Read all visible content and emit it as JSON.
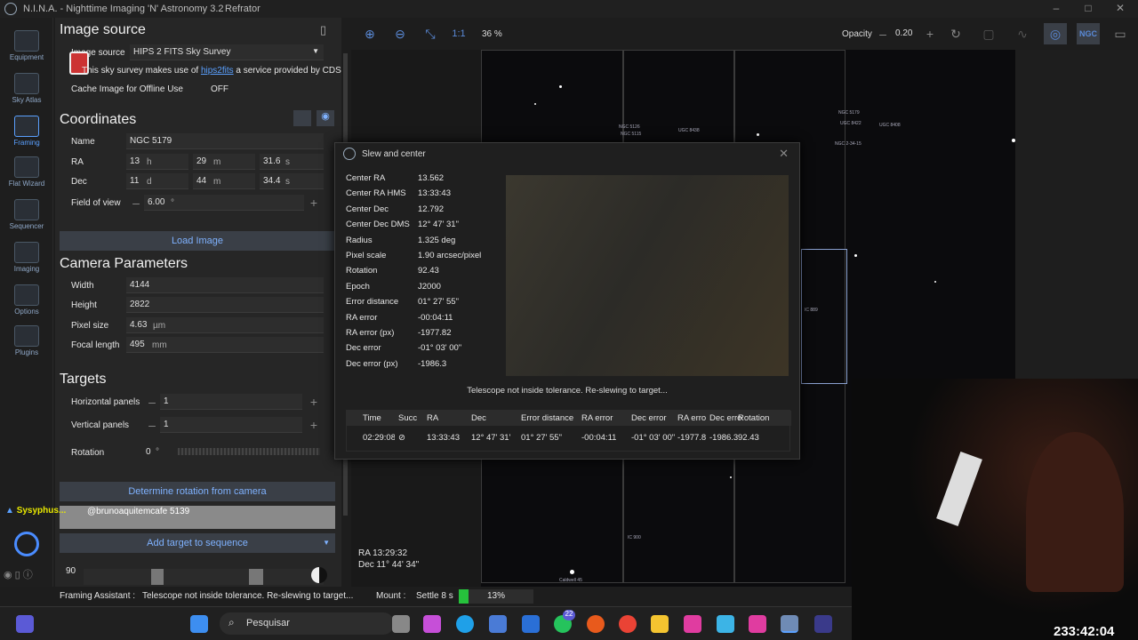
{
  "window": {
    "title": "N.I.N.A. - Nighttime Imaging 'N' Astronomy 3.2",
    "profile": "Refrator"
  },
  "sidebar": {
    "items": [
      {
        "label": "Equipment"
      },
      {
        "label": "Sky Atlas"
      },
      {
        "label": "Framing"
      },
      {
        "label": "Flat Wizard"
      },
      {
        "label": "Sequencer"
      },
      {
        "label": "Imaging"
      },
      {
        "label": "Options"
      },
      {
        "label": "Plugins"
      }
    ],
    "collapse": "< <"
  },
  "image_source": {
    "header": "Image source",
    "label": "Image source",
    "value": "HIPS 2 FITS Sky Survey",
    "note_prefix": "This sky survey makes use of",
    "note_link": "hips2fits",
    "note_suffix": "a service provided by CDS",
    "cache_label": "Cache Image for Offline Use",
    "cache_value": "OFF"
  },
  "coordinates": {
    "header": "Coordinates",
    "name_label": "Name",
    "name": "NGC 5179",
    "ra_label": "RA",
    "ra_h": "13",
    "ra_h_unit": "h",
    "ra_m": "29",
    "ra_m_unit": "m",
    "ra_s": "31.6",
    "ra_s_unit": "s",
    "dec_label": "Dec",
    "dec_d": "11",
    "dec_d_unit": "d",
    "dec_m": "44",
    "dec_m_unit": "m",
    "dec_s": "34.4",
    "dec_s_unit": "s",
    "fov_label": "Field of view",
    "fov": "6.00",
    "fov_unit": "°",
    "load": "Load Image"
  },
  "camera": {
    "header": "Camera Parameters",
    "width_label": "Width",
    "width": "4144",
    "height_label": "Height",
    "height": "2822",
    "pixel_label": "Pixel size",
    "pixel": "4.63",
    "pixel_unit": "µm",
    "focal_label": "Focal length",
    "focal": "495",
    "focal_unit": "mm"
  },
  "targets": {
    "header": "Targets",
    "hpanels_label": "Horizontal panels",
    "hpanels": "1",
    "vpanels_label": "Vertical panels",
    "vpanels": "1",
    "rotation_label": "Rotation",
    "rotation": "0",
    "rotation_unit": "°",
    "determine": "Determine rotation from camera",
    "add": "Add target to sequence"
  },
  "chat": {
    "user": "Sysyphus...",
    "message": "@brunoaquitemcafe 5139"
  },
  "bottom_value": "90",
  "toolbar": {
    "zoom_11": "1:1",
    "zoom": "36 %",
    "opacity_label": "Opacity",
    "opacity": "0.20",
    "ngc": "NGC"
  },
  "sky": {
    "ra": "RA  13:29:32",
    "dec": "Dec  11° 44' 34\"",
    "labels": [
      "NGC 5126",
      "NGC 5115",
      "UGC 8438",
      "NGC 5179",
      "UGC 8422",
      "UGC 8408",
      "NGC 2-34-15",
      "IC 889",
      "IC 900",
      "Caldwell 45"
    ]
  },
  "dialog": {
    "title": "Slew and center",
    "rows": [
      {
        "k": "Center RA",
        "v": "13.562"
      },
      {
        "k": "Center RA HMS",
        "v": "13:33:43"
      },
      {
        "k": "Center Dec",
        "v": "12.792"
      },
      {
        "k": "Center Dec DMS",
        "v": "12° 47' 31\""
      },
      {
        "k": "Radius",
        "v": "1.325 deg"
      },
      {
        "k": "Pixel scale",
        "v": "1.90 arcsec/pixel"
      },
      {
        "k": "Rotation",
        "v": "92.43"
      },
      {
        "k": "Epoch",
        "v": "J2000"
      },
      {
        "k": "Error distance",
        "v": "01° 27' 55\""
      },
      {
        "k": "RA error",
        "v": "-00:04:11"
      },
      {
        "k": "RA error (px)",
        "v": "-1977.82"
      },
      {
        "k": "Dec error",
        "v": "-01° 03' 00\""
      },
      {
        "k": "Dec error (px)",
        "v": "-1986.3"
      }
    ],
    "message": "Telescope not inside tolerance. Re-slewing to target...",
    "columns": [
      "Time",
      "Succ",
      "RA",
      "Dec",
      "Error distance",
      "RA error",
      "Dec error",
      "RA erro",
      "Dec erro",
      "Rotation"
    ],
    "row": [
      "02:29:08",
      "⊘",
      "13:33:43",
      "12° 47' 31\"",
      "01° 27' 55\"",
      "-00:04:11",
      "-01° 03' 00\"",
      "-1977.8",
      "-1986.3",
      "92.43"
    ]
  },
  "status": {
    "framing_label": "Framing Assistant :",
    "framing_msg": "Telescope not inside tolerance. Re-slewing to target...",
    "mount_label": "Mount :",
    "mount_msg": "Settle 8 s",
    "progress_pct": 13,
    "progress_text": "13%"
  },
  "taskbar": {
    "search": "Pesquisar",
    "badge": "22"
  },
  "clock": "233:42:04"
}
